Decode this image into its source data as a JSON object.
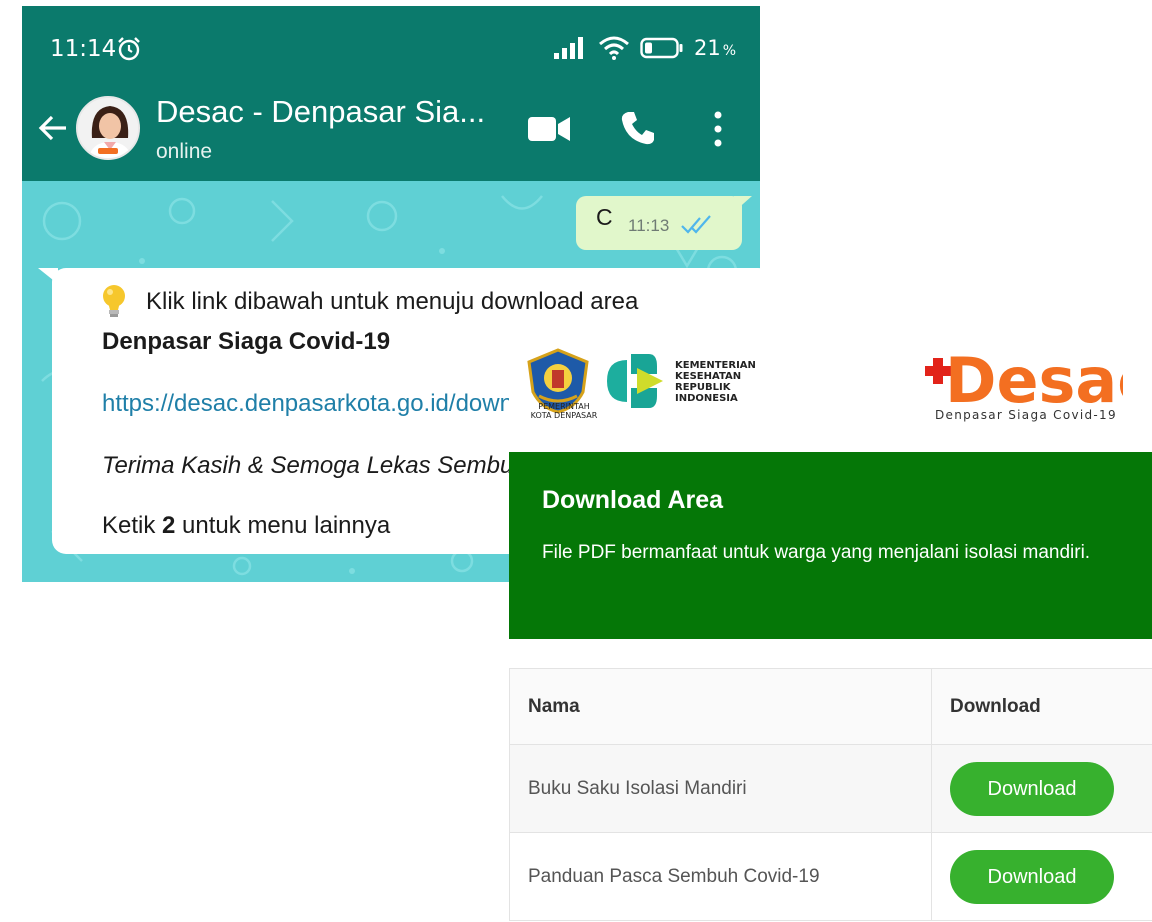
{
  "status_bar": {
    "time": "11:14",
    "battery": "21",
    "battery_suffix": "%"
  },
  "chat_header": {
    "name": "Desac - Denpasar Sia...",
    "status": "online"
  },
  "messages": {
    "outgoing": {
      "text": "C",
      "time": "11:13"
    },
    "incoming": {
      "line1": "Klik link dibawah untuk menuju download area",
      "line2": "Denpasar Siaga Covid-19",
      "line3": "https://desac.denpasarkota.go.id/down",
      "line4": "Terima Kasih & Semoga Lekas Sembuh",
      "line5_pre": "Ketik ",
      "line5_bold": "2",
      "line5_post": " untuk menu lainnya"
    }
  },
  "web": {
    "logos": {
      "pemkot_line1": "PEMERINTAH",
      "pemkot_line2": "KOTA DENPASAR",
      "kemenkes_line1": "KEMENTERIAN",
      "kemenkes_line2": "KESEHATAN",
      "kemenkes_line3": "REPUBLIK",
      "kemenkes_line4": "INDONESIA",
      "desac_tagline": "Denpasar Siaga Covid-19"
    },
    "banner": {
      "title": "Download Area",
      "description": "File PDF bermanfaat untuk warga yang menjalani isolasi mandiri."
    },
    "table": {
      "header_name": "Nama",
      "header_download": "Download",
      "rows": [
        {
          "name": "Buku Saku Isolasi Mandiri",
          "button": "Download"
        },
        {
          "name": "Panduan Pasca Sembuh Covid-19",
          "button": "Download"
        }
      ]
    }
  },
  "colors": {
    "wa_header": "#0b7a6c",
    "chat_bg": "#5fd0d4",
    "banner_green": "#057707",
    "button_green": "#37b12e",
    "desac_orange": "#f36f21",
    "desac_red": "#e2231a"
  },
  "icons": [
    "alarm-icon",
    "signal-icon",
    "wifi-icon",
    "battery-icon",
    "back-arrow-icon",
    "video-call-icon",
    "phone-call-icon",
    "more-options-icon",
    "read-ticks-icon",
    "lightbulb-icon"
  ]
}
